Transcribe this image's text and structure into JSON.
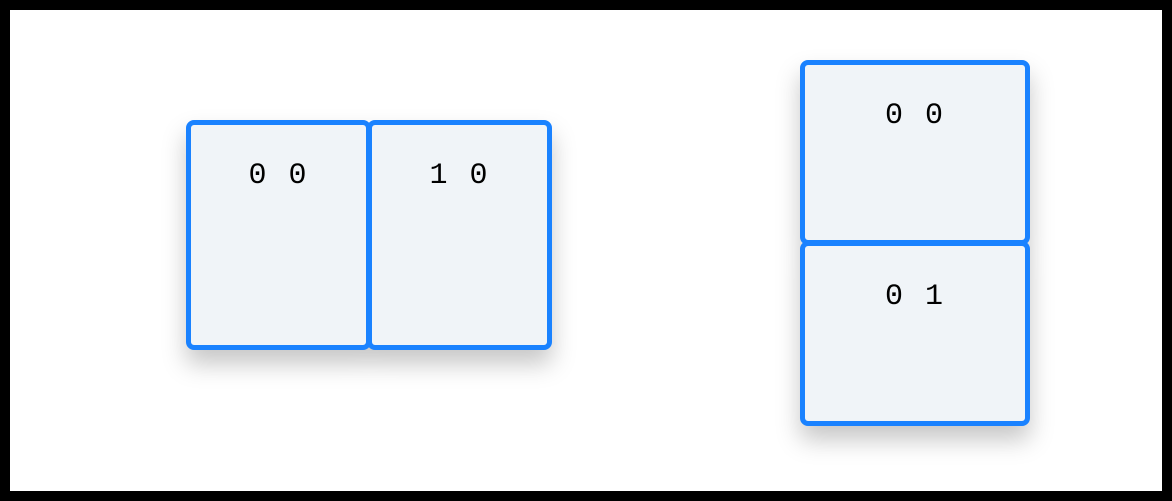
{
  "diagram": {
    "groups": [
      {
        "id": "horizontal",
        "orientation": "row",
        "boxes": [
          {
            "label": "0 0"
          },
          {
            "label": "1 0"
          }
        ]
      },
      {
        "id": "vertical",
        "orientation": "column",
        "boxes": [
          {
            "label": "0 0"
          },
          {
            "label": "0 1"
          }
        ]
      }
    ]
  },
  "colors": {
    "box_border": "#1a82ff",
    "box_fill": "#f0f4f8",
    "canvas_bg": "#ffffff",
    "page_bg": "#000000"
  }
}
